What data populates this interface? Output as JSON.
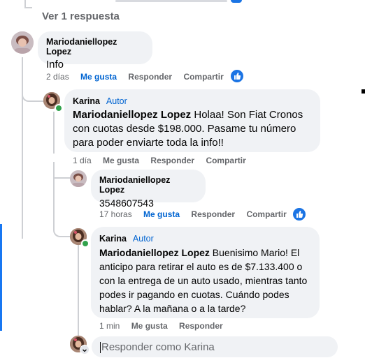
{
  "view_replies": "Ver 1 respuesta",
  "actions": {
    "like": "Me gusta",
    "reply": "Responder",
    "share": "Compartir"
  },
  "comments": [
    {
      "author": "Mariodaniellopez Lopez",
      "text": "Info",
      "time": "2 días",
      "liked": true
    },
    {
      "author": "Karina",
      "badge": "Autor",
      "mention": "Mariodaniellopez Lopez",
      "text": " Holaa! Son Fiat Cronos con cuotas desde $198.000. Pasame tu número para poder enviarte toda la info!!",
      "time": "1 día",
      "liked": false
    },
    {
      "author": "Mariodaniellopez Lopez",
      "text": "3548607543",
      "time": "17 horas",
      "liked": true
    },
    {
      "author": "Karina",
      "badge": "Autor",
      "mention": "Mariodaniellopez Lopez",
      "text": " Buenisimo Mario! El anticipo para retirar el auto es de $7.133.400 o con la entrega de un auto usado, mientras tanto podes ir pagando en cuotas. Cuándo podes hablar? A la mañana o a la tarde?",
      "time": "1 min",
      "liked": false
    }
  ],
  "reply_box": {
    "placeholder": "Responder como Karina"
  },
  "colors": {
    "accent": "#0064d1",
    "bubble": "#f0f2f5",
    "meta": "#65676b",
    "online": "#31a24c"
  }
}
